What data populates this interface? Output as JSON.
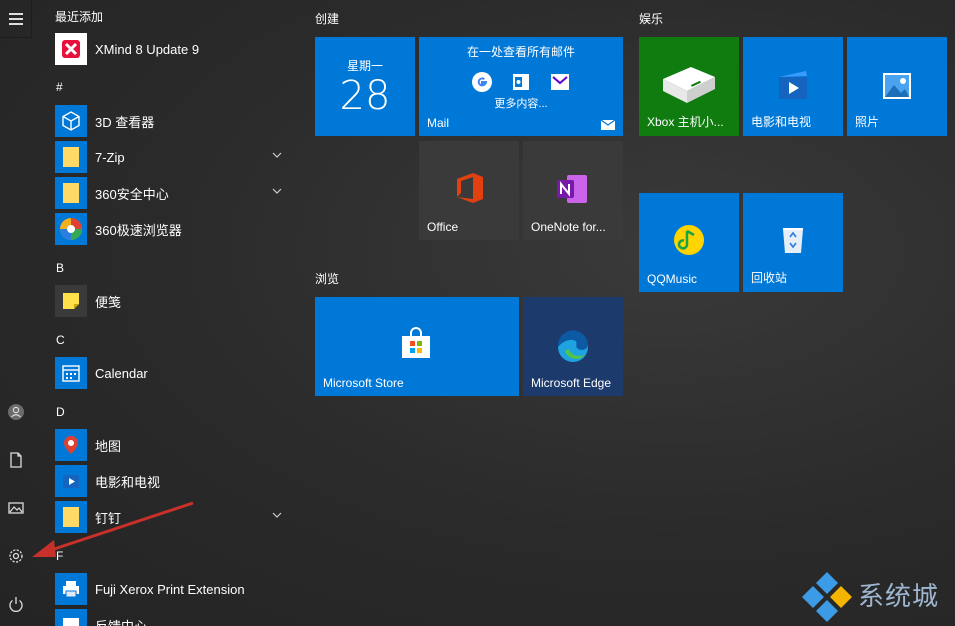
{
  "rail": {
    "items": [
      "menu-icon",
      "user-icon",
      "document-icon",
      "pictures-icon",
      "settings-icon",
      "power-icon"
    ]
  },
  "applist": {
    "recent_header": "最近添加",
    "apps": [
      {
        "name": "XMind 8 Update 9",
        "icon": "xmind-icon",
        "color": "#ffffff",
        "expand": false
      },
      {
        "name": "3D 查看器",
        "icon": "3d-viewer-icon",
        "color": "#0078d7",
        "expand": false
      },
      {
        "name": "7-Zip",
        "icon": "folder-icon",
        "color": "#0078d7",
        "expand": true
      },
      {
        "name": "360安全中心",
        "icon": "folder-icon",
        "color": "#0078d7",
        "expand": true
      },
      {
        "name": "360极速浏览器",
        "icon": "360-browser-icon",
        "color": "#0078d7",
        "expand": false
      },
      {
        "name": "便笺",
        "icon": "sticky-notes-icon",
        "color": "#3a3a3a",
        "expand": false
      },
      {
        "name": "Calendar",
        "icon": "calendar-icon",
        "color": "#0078d7",
        "expand": false
      },
      {
        "name": "地图",
        "icon": "maps-icon",
        "color": "#0078d7",
        "expand": false
      },
      {
        "name": "电影和电视",
        "icon": "movies-icon",
        "color": "#0078d7",
        "expand": false
      },
      {
        "name": "钉钉",
        "icon": "folder-icon",
        "color": "#0078d7",
        "expand": true
      },
      {
        "name": "Fuji Xerox Print Extension",
        "icon": "printer-icon",
        "color": "#0078d7",
        "expand": false
      },
      {
        "name": "反馈中心",
        "icon": "feedback-icon",
        "color": "#0078d7",
        "expand": false
      }
    ],
    "letters": [
      "#",
      "B",
      "C",
      "D",
      "F"
    ]
  },
  "groups": {
    "create": "创建",
    "browse": "浏览",
    "entertainment": "娱乐"
  },
  "tiles": {
    "calendar_day": "星期一",
    "calendar_num": "28",
    "mail_top": "在一处查看所有邮件",
    "mail_more": "更多内容...",
    "mail_label": "Mail",
    "office": "Office",
    "onenote": "OneNote for...",
    "store": "Microsoft Store",
    "edge": "Microsoft Edge",
    "xbox": "Xbox 主机小...",
    "movies": "电影和电视",
    "photos": "照片",
    "qqmusic": "QQMusic",
    "recycle": "回收站"
  },
  "watermark": "系统城"
}
